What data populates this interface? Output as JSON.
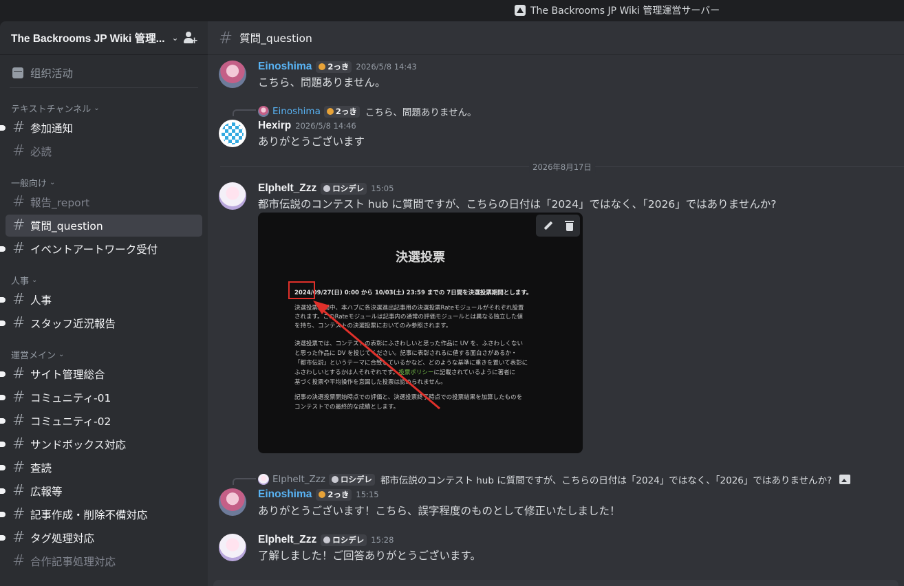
{
  "window": {
    "title": "The Backrooms JP Wiki 管理運営サーバー"
  },
  "server": {
    "name": "The Backrooms JP Wiki 管理..."
  },
  "sidebar": {
    "events_label": "组织活动",
    "categories": [
      {
        "label": "テキストチャンネル",
        "channels": [
          "参加通知",
          "必読"
        ]
      },
      {
        "label": "一般向け",
        "channels": [
          "報告_report",
          "質問_question",
          "イベントアートワーク受付"
        ]
      },
      {
        "label": "人事",
        "channels": [
          "人事",
          "スタッフ近況報告"
        ]
      },
      {
        "label": "運営メイン",
        "channels": [
          "サイト管理総合",
          "コミュニティ-01",
          "コミュニティ-02",
          "サンドボックス対応",
          "査読",
          "広報等",
          "記事作成・削除不備対応",
          "タグ処理対応",
          "合作記事処理対応"
        ]
      }
    ]
  },
  "channel": {
    "name": "質問_question"
  },
  "messages": {
    "m1": {
      "author": "Einoshima",
      "tag": "2っき",
      "time": "2026/5/8 14:43",
      "text": "こちら、問題ありません。"
    },
    "m2": {
      "reply_author": "Einoshima",
      "reply_tag": "2っき",
      "reply_text": "こちら、問題ありません。",
      "author": "Hexirp",
      "time": "2026/5/8 14:46",
      "text": "ありがとうございます"
    },
    "divider": "2026年8月17日",
    "m3": {
      "author": "Elphelt_Zzz",
      "tag": "ロシデレ",
      "time": "15:05",
      "text": "都市伝説のコンテスト hub に質問ですが、こちらの日付は「2024」ではなく、「2026」ではありませんか?"
    },
    "m4": {
      "reply_author": "Elphelt_Zzz",
      "reply_tag": "ロシデレ",
      "reply_text": "都市伝説のコンテスト hub に質問ですが、こちらの日付は「2024」ではなく、「2026」ではありませんか?",
      "author": "Einoshima",
      "tag": "2っき",
      "time": "15:15",
      "text": "ありがとうございます！こちら、誤字程度のものとして修正いたしました！"
    },
    "m5": {
      "author": "Elphelt_Zzz",
      "tag": "ロシデレ",
      "time": "15:28",
      "text": "了解しました！ご回答ありがとうございます。"
    }
  },
  "attachment": {
    "title": "決選投票",
    "lines": [
      "2024/09/27(日) 0:00 から 10/03(土) 23:59 までの 7日間を決選投票期間とします。",
      "決選投票期間中、本ハブに各決選進出記事用の決選投票Rateモジュールがそれぞれ設置",
      "されます。このRateモジュールは記事内の通常の評価モジュールとは異なる独立した値",
      "を持ち、コンテストの決選投票においてのみ参照されます。",
      "決選投票では、コンテストの表彰にふさわしいと思った作品に UV を、ふさわしくない",
      "と思った作品に DV を投じてください。記事に表彰されるに値する面白さがあるか・",
      "「都市伝説」というテーマに合致しているかなど、どのような基準に重きを置いて表彰に",
      "ふさわしいとするかは人それぞれです。",
      "投票ポリシー",
      "に記載されているように著者に",
      "基づく投票や平均操作を意図した投票は認められません。",
      "記事の決選投票開始時点での評価と、決選投票終了時点での投票結果を加算したものを",
      "コンテストでの最終的な成績とします。"
    ]
  }
}
